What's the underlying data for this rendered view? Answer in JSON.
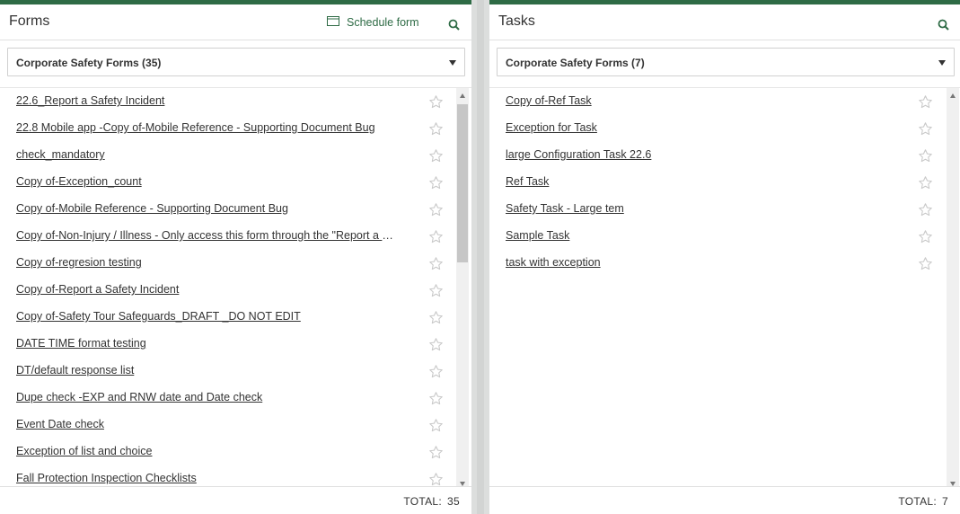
{
  "forms": {
    "title": "Forms",
    "schedule_label": "Schedule form",
    "dropdown_value": "Corporate Safety Forms (35)",
    "items": [
      "22.6_Report a Safety Incident",
      "22.8 Mobile app -Copy of-Mobile Reference - Supporting Document Bug",
      "check_mandatory",
      "Copy of-Exception_count",
      "Copy of-Mobile Reference - Supporting Document Bug",
      "Copy of-Non-Injury / Illness - Only access this form through the \"Report a Safety Incident\" form",
      "Copy of-regresion testing",
      "Copy of-Report a Safety Incident",
      "Copy of-Safety Tour Safeguards_DRAFT _DO NOT EDIT",
      "DATE TIME format testing",
      "DT/default response list",
      "Dupe check -EXP and RNW date and Date check",
      "Event Date check",
      "Exception of list and choice",
      "Fall Protection Inspection Checklists"
    ],
    "total_label": "TOTAL:",
    "total_value": "35"
  },
  "tasks": {
    "title": "Tasks",
    "dropdown_value": "Corporate Safety Forms (7)",
    "items": [
      "Copy of-Ref Task",
      "Exception for Task",
      "large Configuration Task 22.6",
      "Ref Task",
      "Safety Task - Large tem",
      "Sample Task",
      "task with exception"
    ],
    "total_label": "TOTAL:",
    "total_value": "7"
  },
  "colors": {
    "accent": "#2e6b45",
    "star_outline": "#c8c8c8"
  },
  "icons": {
    "schedule": "calendar-icon",
    "search": "search-icon",
    "favorite": "star-outline-icon",
    "dropdown": "caret-down-icon"
  }
}
